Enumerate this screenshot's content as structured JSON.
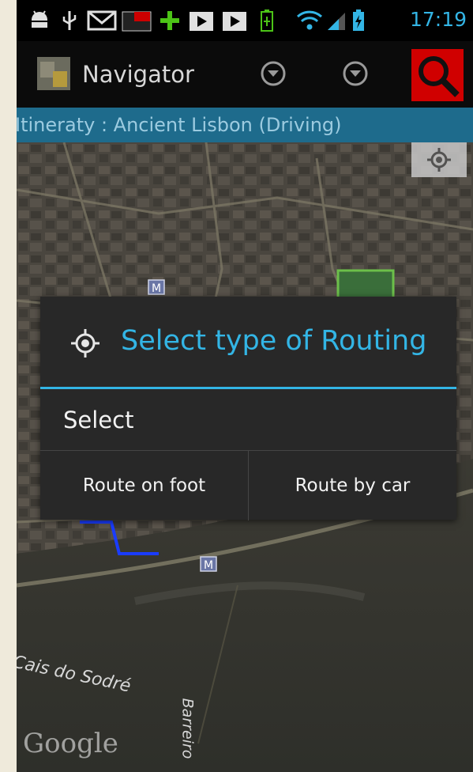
{
  "status_bar": {
    "time": "17:19",
    "icons": [
      "android-debug-icon",
      "usb-icon",
      "gmail-icon",
      "gsma-icon",
      "plus-icon",
      "play-store-icon",
      "play-store-icon",
      "battery-saver-icon",
      "wifi-icon",
      "signal-icon",
      "battery-charging-icon"
    ]
  },
  "action_bar": {
    "title": "Navigator",
    "icons": [
      "app-icon",
      "dropdown-icon",
      "dropdown-icon",
      "search-icon"
    ]
  },
  "itinerary": {
    "text": "Itineraty : Ancient Lisbon (Driving)"
  },
  "map": {
    "labels": {
      "cais": "Cais do Sodré",
      "barreiro": "Barreiro",
      "google": "Google"
    }
  },
  "dialog": {
    "title": "Select type of Routing",
    "message": "Select",
    "buttons": {
      "foot": "Route on foot",
      "car": "Route by car"
    }
  },
  "colors": {
    "accent": "#33b5e5",
    "itinerary_bg": "#1e6b8c",
    "dialog_bg": "#282828",
    "search_bg": "#d00000"
  }
}
